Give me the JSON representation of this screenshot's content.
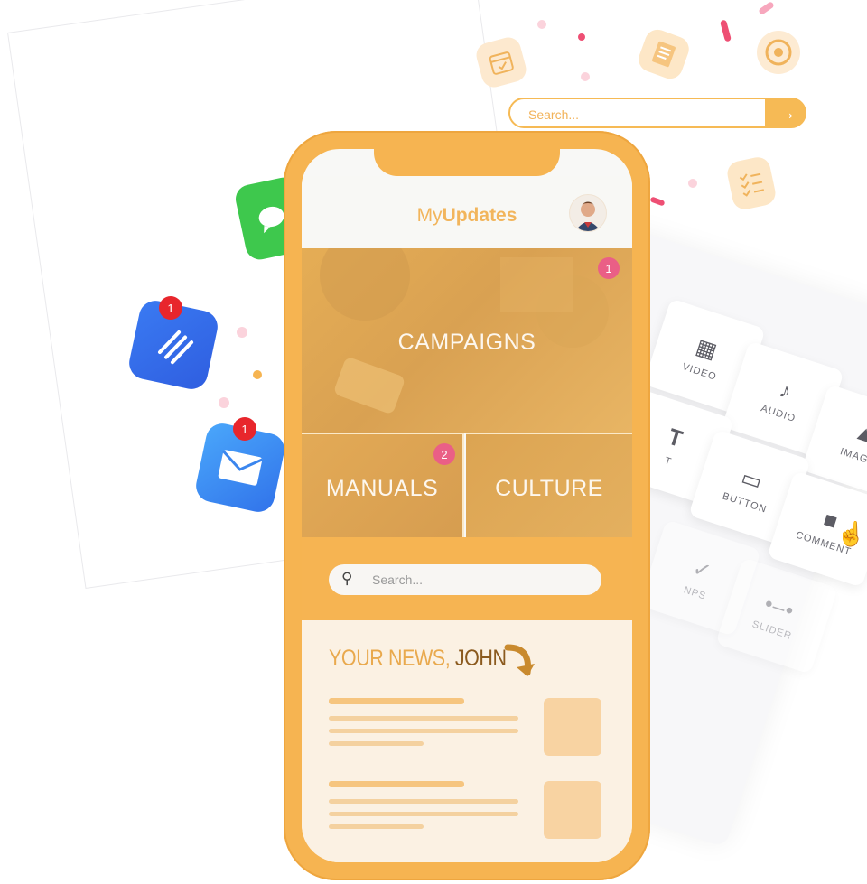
{
  "colors": {
    "accent": "#f6b451",
    "badge": "#ea5f86",
    "news_bg": "#fbf1e3"
  },
  "top_search": {
    "placeholder": "Search...",
    "button_icon": "arrow-right-icon"
  },
  "app": {
    "title_light": "My",
    "title_bold": "Updates",
    "avatar_icon": "user-avatar"
  },
  "tiles": {
    "campaigns": {
      "label": "CAMPAIGNS",
      "badge": "1"
    },
    "manuals": {
      "label": "MANUALS",
      "badge": "2"
    },
    "culture": {
      "label": "CULTURE"
    }
  },
  "search": {
    "placeholder": "Search..."
  },
  "news": {
    "title_prefix": "YOUR NEWS, ",
    "title_name": "JOHN"
  },
  "builder_tiles": [
    {
      "label": "VIDEO",
      "icon": "film-icon"
    },
    {
      "label": "AUDIO",
      "icon": "music-note-icon"
    },
    {
      "label": "IMAGE",
      "icon": "image-icon"
    },
    {
      "label": "T",
      "icon": "text-icon"
    },
    {
      "label": "BUTTON",
      "icon": "button-icon"
    },
    {
      "label": "COMMENT",
      "icon": "comment-icon"
    },
    {
      "label": "NPS",
      "icon": "thumbs-icon"
    },
    {
      "label": "SLIDER",
      "icon": "slider-icon"
    }
  ],
  "floating_badges": {
    "list_app": "1",
    "mail_app": "1"
  }
}
